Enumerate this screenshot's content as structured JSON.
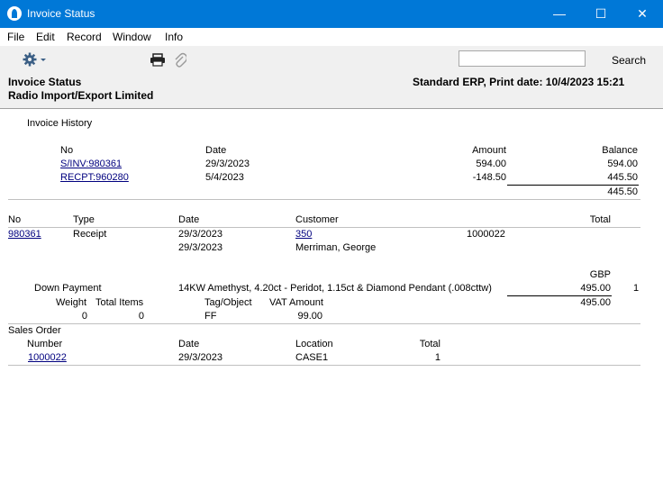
{
  "window": {
    "title": "Invoice Status",
    "minimize": "—",
    "maximize": "☐",
    "close": "✕"
  },
  "menu": [
    "File",
    "Edit",
    "Record",
    "Window",
    "Info"
  ],
  "toolbar": {
    "search_label": "Search",
    "search_value": ""
  },
  "header": {
    "title": "Invoice Status",
    "company": "Radio Import/Export Limited",
    "print_info": "Standard ERP, Print date:  10/4/2023 15:21"
  },
  "history": {
    "section": "Invoice History",
    "col_no": "No",
    "col_date": "Date",
    "col_amount": "Amount",
    "col_balance": "Balance",
    "rows": [
      {
        "no": "S/INV:980361",
        "date": "29/3/2023",
        "amount": "594.00",
        "balance": "594.00"
      },
      {
        "no": "RECPT:960280",
        "date": "5/4/2023",
        "amount": "-148.50",
        "balance": "445.50"
      }
    ],
    "final_balance": "445.50"
  },
  "invoice": {
    "col_no": "No",
    "col_type": "Type",
    "col_date": "Date",
    "col_customer": "Customer",
    "col_total": "Total",
    "no": "980361",
    "type": "Receipt",
    "date1": "29/3/2023",
    "date2": "29/3/2023",
    "customer_code": "350",
    "customer_name": "Merriman, George",
    "order_ref": "1000022"
  },
  "row": {
    "currency": "GBP",
    "label": "Down Payment",
    "description": "14KW Amethyst, 4.20ct - Peridot, 1.15ct & Diamond Pendant (.008cttw)",
    "amount": "495.00",
    "qty": "1",
    "total": "495.00",
    "weight_label": "Weight",
    "total_items_label": "Total Items",
    "tag_label": "Tag/Object",
    "vat_label": "VAT Amount",
    "weight": "0",
    "total_items": "0",
    "tag": "FF",
    "vat": "99.00"
  },
  "sales_order": {
    "section": "Sales Order",
    "col_number": "Number",
    "col_date": "Date",
    "col_location": "Location",
    "col_total": "Total",
    "number": "1000022",
    "date": "29/3/2023",
    "location": "CASE1",
    "total": "1"
  }
}
